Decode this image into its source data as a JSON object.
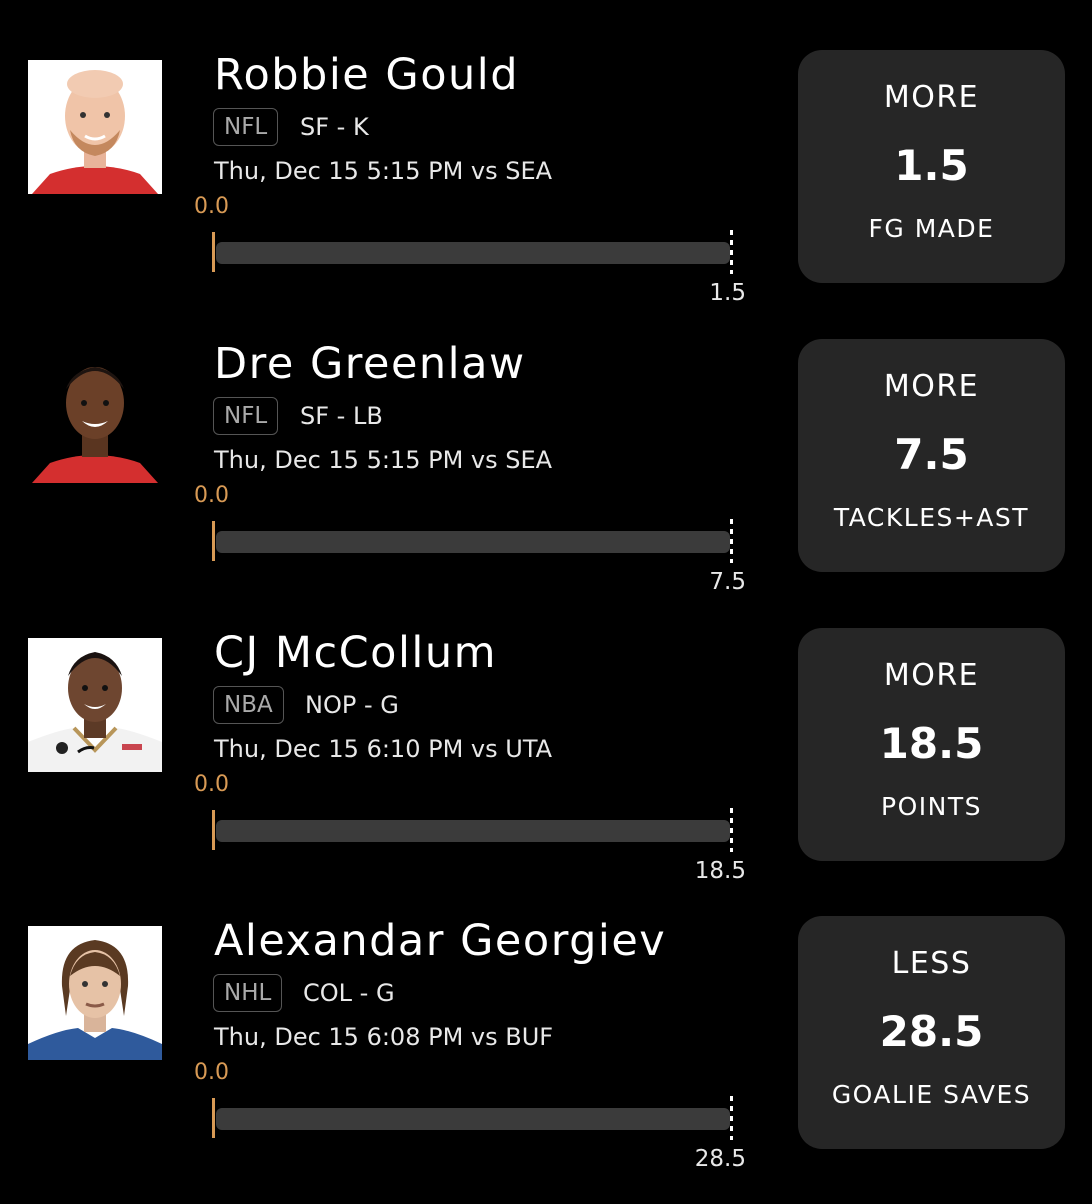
{
  "picks": [
    {
      "player": "Robbie Gould",
      "league": "NFL",
      "team_position": "SF - K",
      "game_time": "Thu, Dec 15 5:15 PM  vs SEA",
      "progress_current": "0.0",
      "progress_target": "1.5",
      "direction": "MORE",
      "line": "1.5",
      "stat": "FG MADE",
      "jersey_color": "#d42f2f",
      "avatar_icon": "player-headshot-icon"
    },
    {
      "player": "Dre Greenlaw",
      "league": "NFL",
      "team_position": "SF - LB",
      "game_time": "Thu, Dec 15 5:15 PM  vs SEA",
      "progress_current": "0.0",
      "progress_target": "7.5",
      "direction": "MORE",
      "line": "7.5",
      "stat": "TACKLES+AST",
      "jersey_color": "#d42f2f",
      "avatar_icon": "player-headshot-icon"
    },
    {
      "player": "CJ McCollum",
      "league": "NBA",
      "team_position": "NOP - G",
      "game_time": "Thu, Dec 15 6:10 PM  vs UTA",
      "progress_current": "0.0",
      "progress_target": "18.5",
      "direction": "MORE",
      "line": "18.5",
      "stat": "POINTS",
      "jersey_color": "#f2f2f2",
      "avatar_icon": "player-headshot-icon"
    },
    {
      "player": "Alexandar Georgiev",
      "league": "NHL",
      "team_position": "COL - G",
      "game_time": "Thu, Dec 15 6:08 PM  vs BUF",
      "progress_current": "0.0",
      "progress_target": "28.5",
      "direction": "LESS",
      "line": "28.5",
      "stat": "GOALIE SAVES",
      "jersey_color": "#2f5a9c",
      "avatar_icon": "player-headshot-icon"
    }
  ],
  "colors": {
    "background": "#000000",
    "card": "#262626",
    "accent_progress": "#d89a55",
    "track": "#3b3b3b",
    "badge_border": "#555555"
  }
}
